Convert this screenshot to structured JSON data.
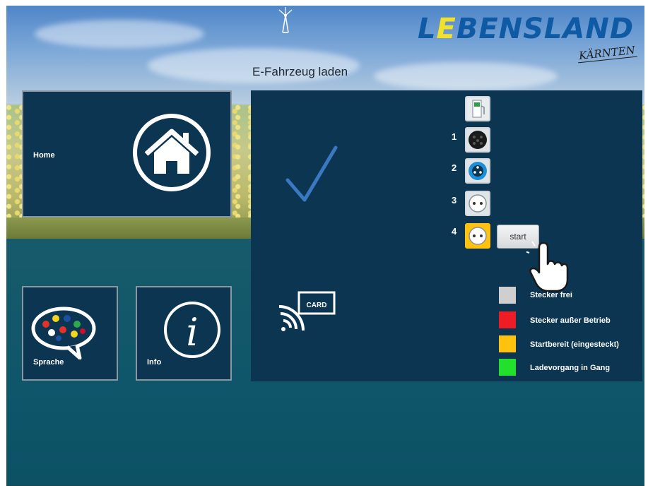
{
  "header": {
    "logo_prefix": "L",
    "logo_highlight": "E",
    "logo_rest": "BENSLAND",
    "logo_sub": "KÄRNTEN",
    "page_title": "E-Fahrzeug laden"
  },
  "tiles": {
    "home_label": "Home",
    "language_label": "Sprache",
    "info_label": "Info"
  },
  "panel": {
    "card_label": "CARD",
    "slots": [
      {
        "number": "",
        "icon": "charging-station-icon"
      },
      {
        "number": "1",
        "icon": "type2-plug-icon"
      },
      {
        "number": "2",
        "icon": "cee-plug-icon"
      },
      {
        "number": "3",
        "icon": "schuko-plug-icon"
      },
      {
        "number": "4",
        "icon": "schuko-plug-icon"
      }
    ],
    "start_label": "start"
  },
  "legend": [
    {
      "label": "Stecker frei",
      "color": "#cfcfcf"
    },
    {
      "label": "Stecker außer Betrieb",
      "color": "#ee1c24"
    },
    {
      "label": "Startbereit (eingesteckt)",
      "color": "#ffc20e"
    },
    {
      "label": "Ladevorgang in Gang",
      "color": "#22e12c"
    }
  ],
  "colors": {
    "panel_bg": "#0b3551",
    "accent_blue": "#0f5aa4",
    "logo_yellow": "#f1e12a",
    "checkmark": "#3a78c2",
    "start_ready": "#ffc20e"
  }
}
